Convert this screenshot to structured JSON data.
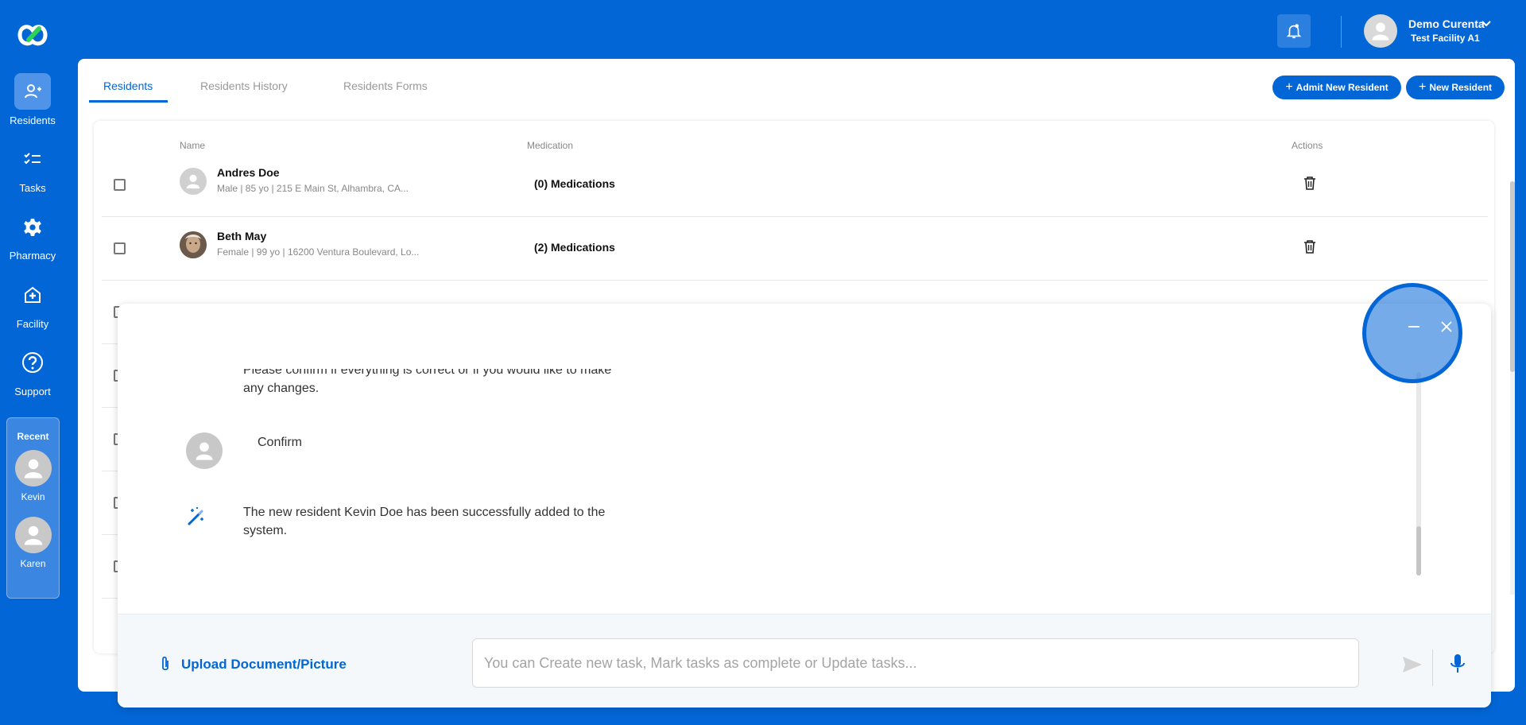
{
  "app": {
    "brand_color": "#0366d6",
    "logo_icon": "curenta-logo-icon"
  },
  "sidebar": {
    "items": [
      {
        "label": "Residents",
        "icon": "residents-icon",
        "active": true
      },
      {
        "label": "Tasks",
        "icon": "tasks-icon",
        "active": false
      },
      {
        "label": "Pharmacy",
        "icon": "gear-icon",
        "active": false
      },
      {
        "label": "Facility",
        "icon": "facility-icon",
        "active": false
      },
      {
        "label": "Support",
        "icon": "help-icon",
        "active": false
      }
    ],
    "recent": {
      "title": "Recent",
      "items": [
        {
          "label": "Kevin"
        },
        {
          "label": "Karen"
        }
      ]
    }
  },
  "header": {
    "notification_icon": "bell-icon",
    "user_name": "Demo Curenta",
    "facility": "Test Facility A1"
  },
  "main": {
    "tabs": [
      {
        "label": "Residents",
        "active": true
      },
      {
        "label": "Residents History",
        "active": false
      },
      {
        "label": "Residents Forms",
        "active": false
      }
    ],
    "buttons": {
      "admit_label": "Admit New Resident",
      "new_label": "New Resident"
    },
    "table": {
      "headers": {
        "name": "Name",
        "medication": "Medication",
        "actions": "Actions"
      },
      "rows": [
        {
          "name": "Andres Doe",
          "details": "Male | 85 yo | 215 E Main St, Alhambra, CA...",
          "medication": "(0) Medications"
        },
        {
          "name": "Beth May",
          "details": "Female | 99 yo | 16200 Ventura Boulevard, Lo...",
          "medication": "(2) Medications"
        }
      ]
    }
  },
  "chat": {
    "messages": {
      "assistant_prompt": "Please confirm if everything is correct or if you would like to make any changes.",
      "user_reply": "Confirm",
      "assistant_result": "The new resident Kevin Doe has been successfully added to the system."
    },
    "upload_label": "Upload Document/Picture",
    "input_placeholder": "You can Create new task, Mark tasks as complete or Update tasks..."
  }
}
